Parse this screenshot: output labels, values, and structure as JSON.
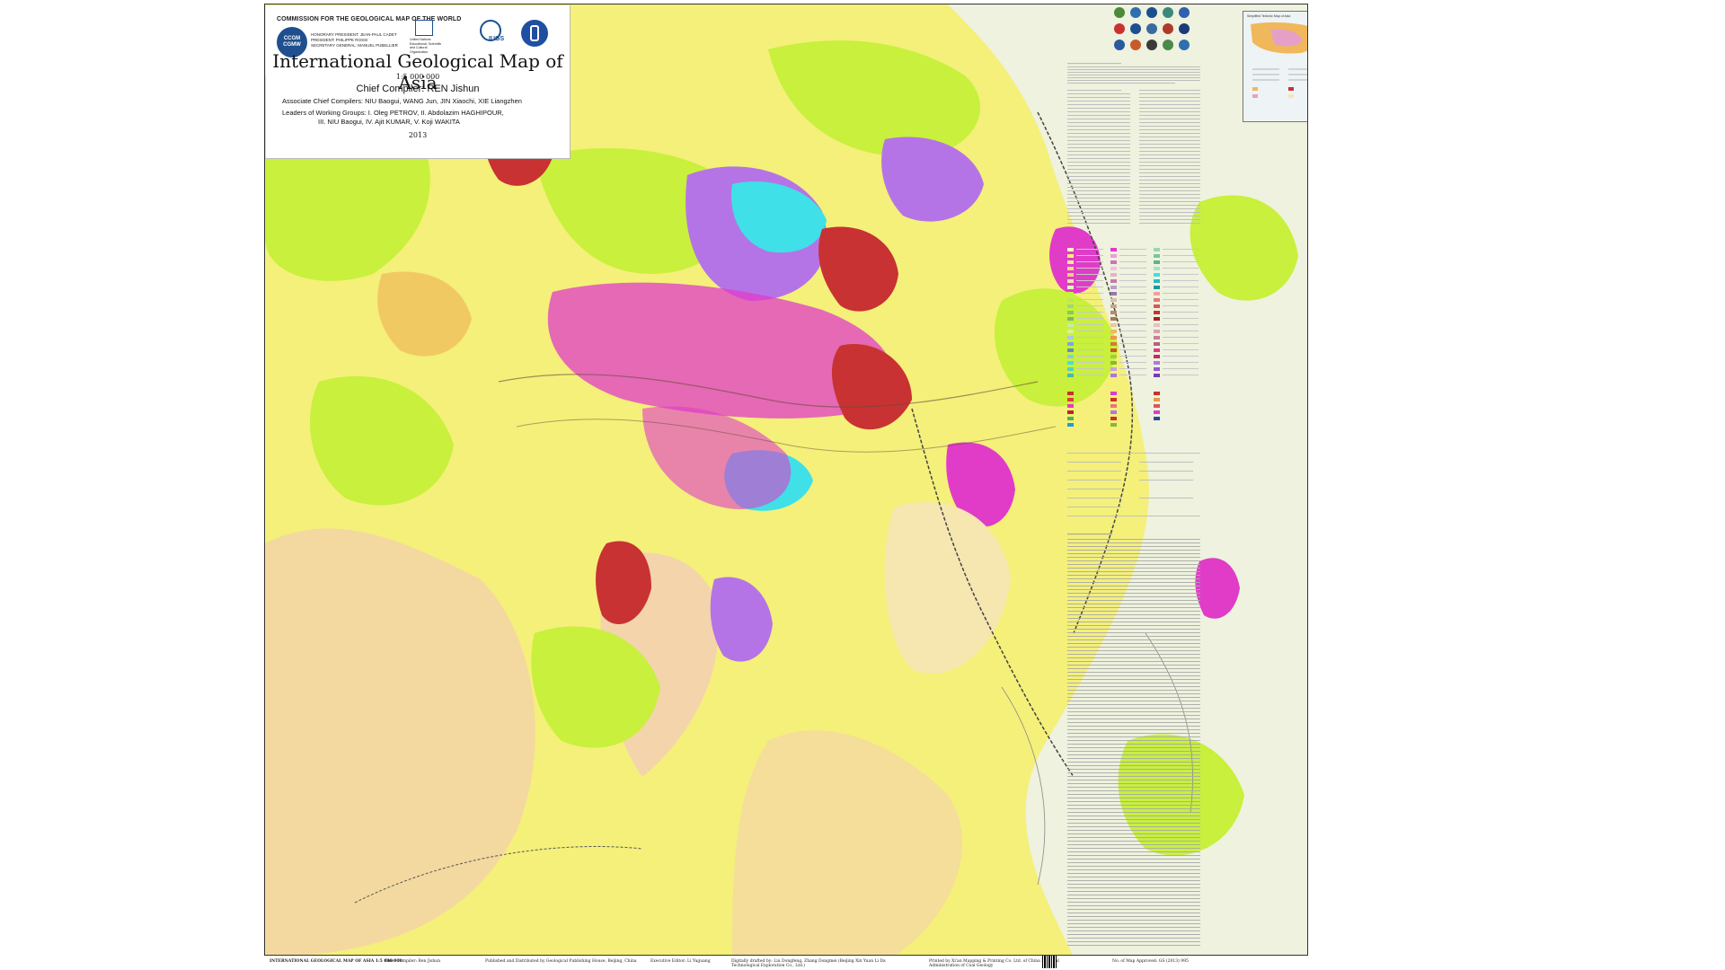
{
  "map": {
    "title": "International Geological Map of Asia",
    "scale": "1:5 000 000",
    "chief_compiler": "Chief Compiler: REN Jishun",
    "associate_compilers": "Associate Chief Compilers:  NIU Baogui, WANG Jun, JIN Xiaochi, XIE Liangzhen",
    "leaders_line1": "Leaders of Working Groups:  I.  Oleg PETROV,  II.  Abdolazim HAGHIPOUR,",
    "leaders_line2": "III.  NIU Baogui, IV.  Ajit KUMAR, V.  Koji WAKITA",
    "year": "2013"
  },
  "header": {
    "commission": "COMMISSION FOR THE GEOLOGICAL MAP OF THE WORLD",
    "ccgm_logo_text": "CCGM CGMW",
    "officers": [
      "HONORARY PRESIDENT: JEAN-PAUL CADET",
      "PRESIDENT: PHILIPPE ROSSI",
      "SECRETARY GENERAL: MANUEL PUBELLIER"
    ],
    "unesco_text": "United Nations Educational, Scientific and Cultural Organization",
    "iugs_label": "IUGS"
  },
  "inset": {
    "title": "Simplified Tectonic Map of Asia"
  },
  "bottom": {
    "map_label": "INTERNATIONAL GEOLOGICAL MAP OF ASIA 1:5 000 000",
    "compiler": "Chief Compiler: Ren Jishun",
    "publisher": "Published and Distributed by Geological Publishing House, Beijing, China",
    "editor": "Executive Editor: Li Yuguang",
    "digitally": "Digitally drafted by: Liu Dongfeng, Zhang Dongmei (Beijing Xin Yuan Li Da Technological Exploration Co., Ltd.)",
    "printed": "Printed by Xi'an Mapping & Printing Co. Ltd. of China National Administration of Coal Geology",
    "approval": "No. of Map Approved: GS (2013) 995"
  },
  "colors": {
    "yellow": "#f4f07a",
    "lime": "#c8f03c",
    "pink": "#f3c7c0",
    "magenta": "#e03cc8",
    "violet": "#b574e6",
    "cyan": "#3fe0e8",
    "red": "#c83232",
    "sea": "#eef2de"
  }
}
